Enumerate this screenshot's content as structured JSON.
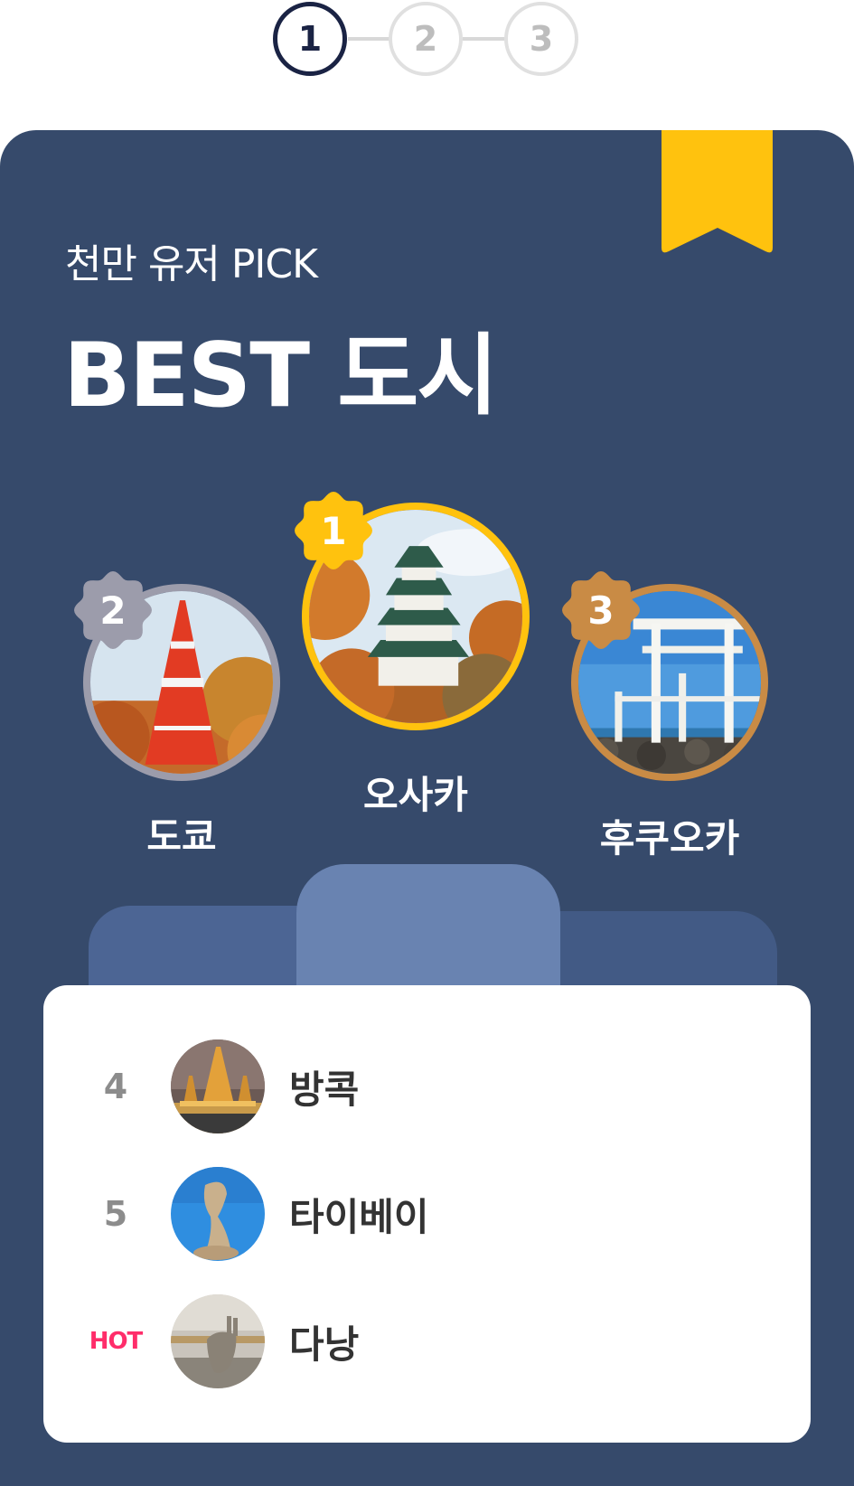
{
  "stepper": {
    "steps": [
      "1",
      "2",
      "3"
    ],
    "active_index": 0
  },
  "header": {
    "subtitle": "천만 유저 PICK",
    "title": "BEST 도시"
  },
  "podium": [
    {
      "rank": "1",
      "name": "오사카",
      "badge_color": "#ffc20e",
      "ring_color": "#ffc20e",
      "image": "osaka-castle"
    },
    {
      "rank": "2",
      "name": "도쿄",
      "badge_color": "#9c9cab",
      "ring_color": "#9c9cab",
      "image": "tokyo-tower"
    },
    {
      "rank": "3",
      "name": "후쿠오카",
      "badge_color": "#c98b45",
      "ring_color": "#c98b45",
      "image": "seaside-torii"
    }
  ],
  "list": [
    {
      "rank": "4",
      "name": "방콕",
      "image": "bangkok-temple"
    },
    {
      "rank": "5",
      "name": "타이베이",
      "image": "taipei-rock"
    },
    {
      "rank": "HOT",
      "name": "다낭",
      "image": "danang-golden-bridge"
    }
  ],
  "colors": {
    "card_bg": "#364a6b",
    "ribbon": "#ffc20e",
    "hot": "#ff2d6a",
    "podium_center": "#6983b1",
    "podium_left": "#4c6594",
    "podium_right": "#425a85"
  }
}
